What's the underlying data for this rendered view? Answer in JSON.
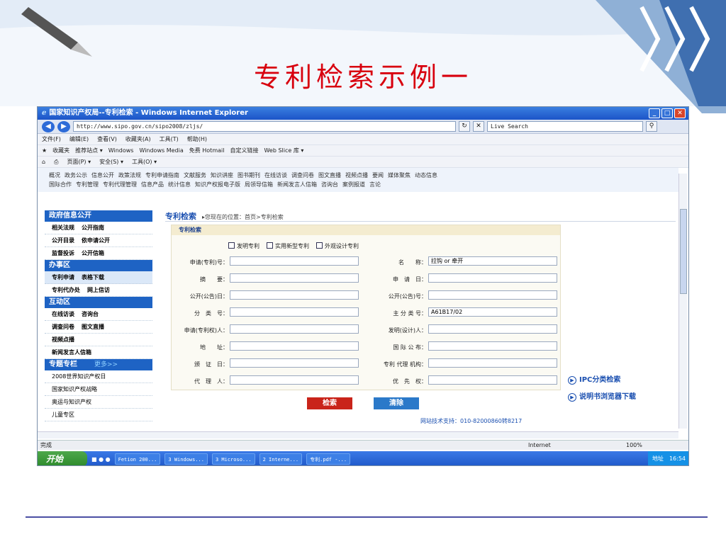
{
  "slide": {
    "title": "专利检索示例一"
  },
  "browser": {
    "window_title": "国家知识产权局--专利检索 - Windows Internet Explorer",
    "url": "http://www.sipo.gov.cn/sipo2008/zljs/",
    "search_engine": "Live Search",
    "menu": [
      "文件(F)",
      "编辑(E)",
      "查看(V)",
      "收藏夹(A)",
      "工具(T)",
      "帮助(H)"
    ],
    "favbar": {
      "label": "收藏夹",
      "items": [
        "推荐站点 ▾",
        "Windows",
        "Windows Media",
        "免费 Hotmail",
        "自定义链接",
        "Web Slice 库 ▾"
      ]
    },
    "cmdbar": [
      "页面(P) ▾",
      "安全(S) ▾",
      "工具(O) ▾"
    ],
    "status": {
      "text": "完成",
      "zone": "Internet",
      "zoom": "100%"
    }
  },
  "site": {
    "topnav_row1": [
      "概况",
      "政务公示",
      "信息公开",
      "政策法规",
      "专利申请指南",
      "文献服务",
      "知识讲座",
      "图书期刊",
      "在线访谈",
      "调查问卷",
      "图文直播",
      "视频点播",
      "要闻",
      "媒体聚焦",
      "动态信息"
    ],
    "topnav_row2": [
      "国际合作",
      "专利管理",
      "专利代理管理",
      "信息产品",
      "统计信息",
      "知识产权报电子版",
      "局领导信箱",
      "新闻发言人信箱",
      "咨询台",
      "案例报道",
      "言论"
    ],
    "sidebar": {
      "sec1": {
        "title": "政府信息公开",
        "rows": [
          [
            "相关法规",
            "公开指南"
          ],
          [
            "公开目录",
            "依申请公开"
          ],
          [
            "监督投诉",
            "公开信箱"
          ]
        ]
      },
      "sec2": {
        "title": "办事区",
        "rows": [
          [
            "专利申请",
            "表格下载"
          ],
          [
            "专利代办处",
            "网上信访"
          ]
        ]
      },
      "sec3": {
        "title": "互动区",
        "rows": [
          [
            "在线访谈",
            "咨询台"
          ],
          [
            "调查问卷",
            "图文直播"
          ],
          [
            "视频点播"
          ],
          [
            "新闻发言人信箱"
          ]
        ]
      },
      "sec4": {
        "title": "专题专栏",
        "more": "更多>>",
        "items": [
          "2008世界知识产权日",
          "国家知识产权战略",
          "奥运与知识产权",
          "儿童专区"
        ]
      }
    },
    "main": {
      "heading": "专利检索",
      "breadcrumb": "▸您现在的位置：首页>专利检索",
      "box_title": "专利检索",
      "types": [
        "发明专利",
        "实用新型专利",
        "外观设计专利"
      ],
      "fields": {
        "app_no": "申请(专利)号：",
        "name": "名　　称：",
        "abstract": "摘　　要：",
        "app_date": "申　请　日：",
        "pub_date": "公开(公告)日：",
        "pub_no": "公开(公告)号：",
        "cls": "分　类　号：",
        "main_cls": "主 分 类 号：",
        "applicant": "申请(专利权)人：",
        "inventor": "发明(设计)人：",
        "address": "地　　址：",
        "intl_pub": "国 际 公 布：",
        "grant_date": "颁　证　日：",
        "agency": "专利 代理 机构：",
        "agent": "代　理　人：",
        "priority": "优　先　权："
      },
      "values": {
        "name": "拉钩 or 牵开",
        "main_cls": "A61B17/02"
      },
      "search_button": "检索",
      "clear_button": "清除",
      "support": "网站技术支持：010-82000860转8217",
      "right_links": [
        "IPC分类检索",
        "说明书浏览器下载"
      ]
    }
  },
  "taskbar": {
    "start": "开始",
    "tasks": [
      "Fetion 200...",
      "3 Windows...",
      "3 Microso...",
      "2 Interne...",
      "专利.pdf -..."
    ],
    "addr": "地址",
    "time": "16:54"
  }
}
